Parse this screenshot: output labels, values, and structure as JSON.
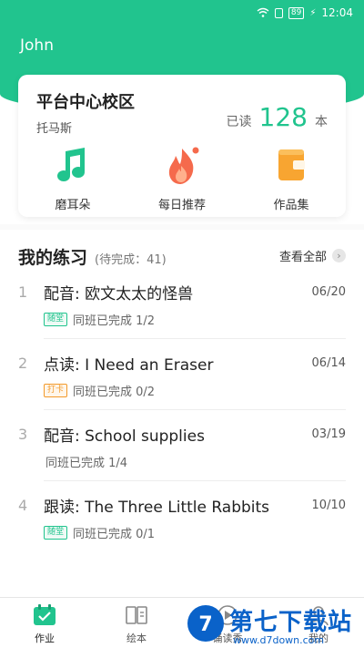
{
  "status_bar": {
    "battery": "89",
    "time": "12:04"
  },
  "user": {
    "name": "John"
  },
  "card": {
    "school": "平台中心校区",
    "teacher": "托马斯",
    "read_label": "已读",
    "read_count": "128",
    "read_unit": "本",
    "quick_actions": [
      {
        "label": "磨耳朵",
        "icon": "music-note-icon"
      },
      {
        "label": "每日推荐",
        "icon": "flame-icon"
      },
      {
        "label": "作品集",
        "icon": "wallet-icon"
      }
    ]
  },
  "practice": {
    "title": "我的练习",
    "pending": "(待完成：41)",
    "view_all": "查看全部",
    "items": [
      {
        "index": "1",
        "title": "配音: 欧文太太的怪兽",
        "date": "06/20",
        "tag": "随堂",
        "tag_color": "#21c48e",
        "progress": "同班已完成 1/2"
      },
      {
        "index": "2",
        "title": "点读: I Need an Eraser",
        "date": "06/14",
        "tag": "打卡",
        "tag_color": "#f39a2b",
        "progress": "同班已完成 0/2"
      },
      {
        "index": "3",
        "title": "配音: School supplies",
        "date": "03/19",
        "tag": "",
        "tag_color": "",
        "progress": "同班已完成 1/4"
      },
      {
        "index": "4",
        "title": "跟读: The Three Little Rabbits",
        "date": "10/10",
        "tag": "随堂",
        "tag_color": "#21c48e",
        "progress": "同班已完成 0/1"
      }
    ]
  },
  "tabs": [
    {
      "label": "作业",
      "icon": "homework-icon",
      "active": true
    },
    {
      "label": "绘本",
      "icon": "picture-book-icon",
      "active": false
    },
    {
      "label": "诵读秀",
      "icon": "reading-show-icon",
      "active": false
    },
    {
      "label": "我的",
      "icon": "profile-icon",
      "active": false
    }
  ],
  "watermark": {
    "title": "第七下载站",
    "url": "www.d7down.com"
  },
  "colors": {
    "accent": "#21c48e",
    "orange": "#f39a2b"
  }
}
